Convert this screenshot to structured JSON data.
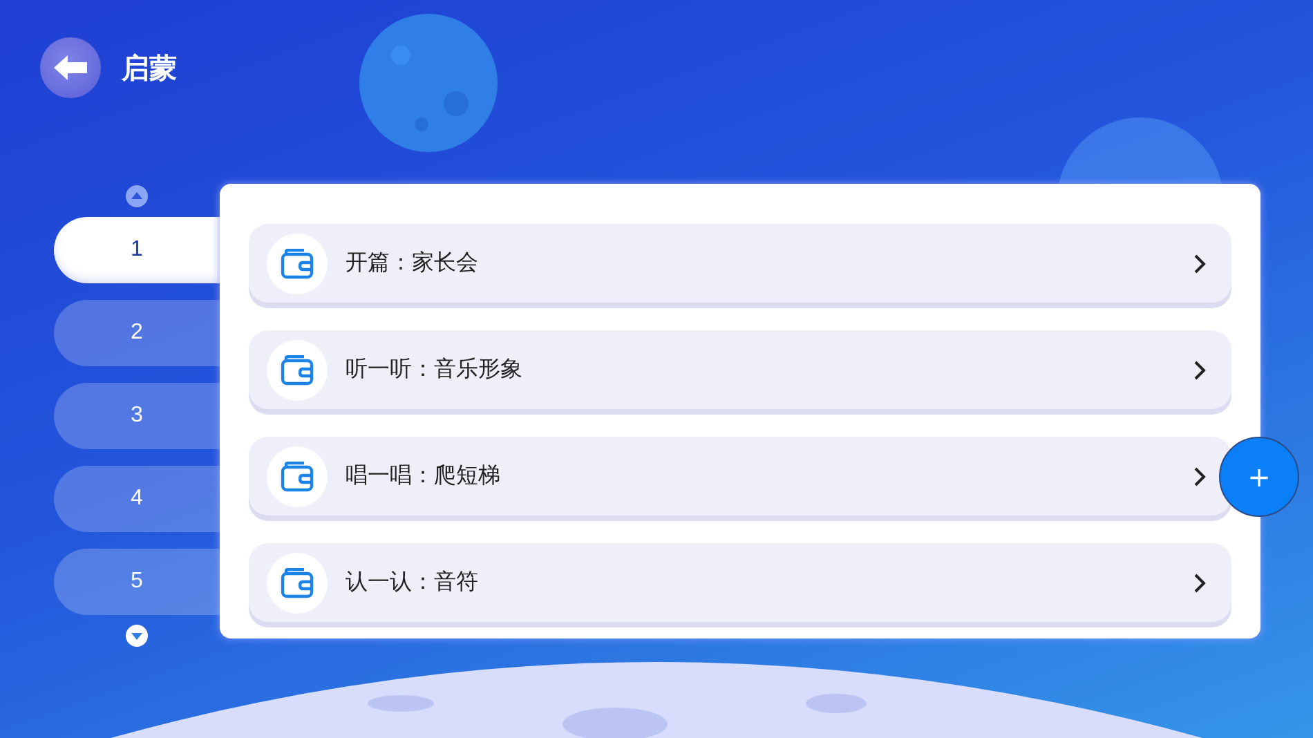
{
  "header": {
    "title": "启蒙"
  },
  "pages": [
    {
      "label": "1",
      "selected": true
    },
    {
      "label": "2",
      "selected": false
    },
    {
      "label": "3",
      "selected": false
    },
    {
      "label": "4",
      "selected": false
    },
    {
      "label": "5",
      "selected": false
    }
  ],
  "lessons": [
    {
      "title": "开篇：家长会"
    },
    {
      "title": "听一听：音乐形象"
    },
    {
      "title": "唱一唱：爬短梯"
    },
    {
      "title": "认一认：音符"
    }
  ],
  "add_button": {
    "label": "+"
  }
}
